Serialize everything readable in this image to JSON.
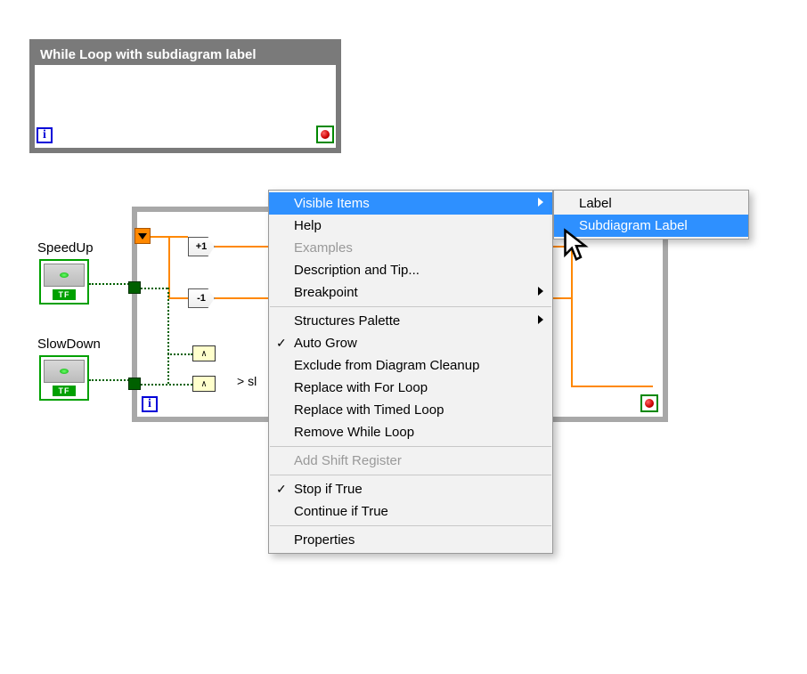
{
  "top_loop": {
    "title": "While Loop with subdiagram label",
    "iteration_glyph": "i"
  },
  "controls": {
    "speedup": {
      "label": "SpeedUp",
      "tf": "TF"
    },
    "slowdown": {
      "label": "SlowDown",
      "tf": "TF"
    }
  },
  "nodes": {
    "inc": "+1",
    "dec": "-1",
    "logic_a": "∧",
    "logic_b": "∧",
    "truncated_text": "> sl"
  },
  "main_loop": {
    "iteration_glyph": "i"
  },
  "context_menu": {
    "items": [
      {
        "label": "Visible Items",
        "submenu": true,
        "highlight": true
      },
      {
        "label": "Help"
      },
      {
        "label": "Examples",
        "disabled": true
      },
      {
        "label": "Description and Tip..."
      },
      {
        "label": "Breakpoint",
        "submenu": true
      },
      {
        "sep": true
      },
      {
        "label": "Structures Palette",
        "submenu": true
      },
      {
        "label": "Auto Grow",
        "checked": true
      },
      {
        "label": "Exclude from Diagram Cleanup"
      },
      {
        "label": "Replace with For Loop"
      },
      {
        "label": "Replace with Timed Loop"
      },
      {
        "label": "Remove While Loop"
      },
      {
        "sep": true
      },
      {
        "label": "Add Shift Register",
        "disabled": true
      },
      {
        "sep": true
      },
      {
        "label": "Stop if True",
        "checked": true
      },
      {
        "label": "Continue if True"
      },
      {
        "sep": true
      },
      {
        "label": "Properties"
      }
    ],
    "submenu_items": [
      {
        "label": "Label"
      },
      {
        "label": "Subdiagram Label",
        "highlight": true
      }
    ]
  }
}
